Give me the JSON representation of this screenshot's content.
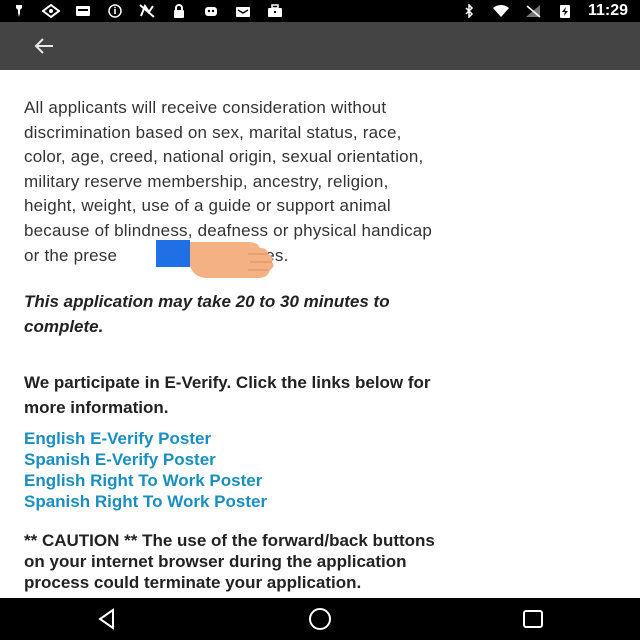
{
  "status_bar": {
    "time": "11:29",
    "left_icons": [
      "pin-icon",
      "navigation-icon",
      "card-icon",
      "info-icon",
      "signal-off-icon",
      "lock-icon",
      "android-icon",
      "mail-icon",
      "briefcase-icon"
    ],
    "right_icons": [
      "bluetooth-icon",
      "wifi-icon",
      "no-signal-icon",
      "battery-charging-icon"
    ]
  },
  "app_bar": {
    "back_icon": "arrow-left-icon"
  },
  "content": {
    "eeo_lines": [
      "All applicants will receive consideration without",
      "discrimination based on sex, marital status, race,",
      "color, age, creed, national origin, sexual orientation,",
      "military reserve membership, ancestry, religion,",
      "height, weight, use of a guide or support animal",
      "because of blindness, deafness or physical handicap",
      "or the prese",
      "abilities."
    ],
    "time_note_lines": [
      "This application may take 20 to 30 minutes to",
      "complete."
    ],
    "everify_lines": [
      "We participate in E-Verify. Click the links below for",
      "more information."
    ],
    "links": [
      "English E-Verify Poster",
      "Spanish E-Verify Poster",
      "English Right To Work Poster",
      "Spanish Right To Work Poster"
    ],
    "caution_lines": [
      "** CAUTION ** The use of the forward/back buttons",
      "on your internet browser during the application",
      "process could terminate your application."
    ]
  },
  "overlay": {
    "marker_color": "#1f6fe5",
    "hand_color": "#f4b183"
  },
  "nav_bar": {
    "buttons": [
      "back-triangle-icon",
      "home-circle-icon",
      "recents-square-icon"
    ]
  },
  "colors": {
    "status_bar": "#000000",
    "app_bar": "#444444",
    "link": "#1a8fbf",
    "text": "#222222"
  }
}
